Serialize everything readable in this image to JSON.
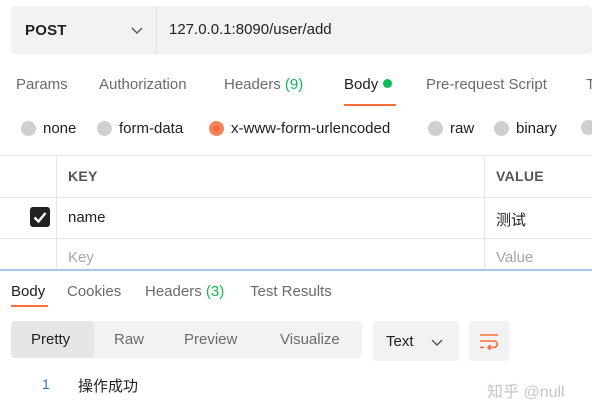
{
  "request": {
    "method": "POST",
    "url": "127.0.0.1:8090/user/add"
  },
  "request_tabs": {
    "params": "Params",
    "authorization": "Authorization",
    "headers": "Headers",
    "headers_count": "(9)",
    "body": "Body",
    "prerequest": "Pre-request Script",
    "tests_partial": "T"
  },
  "body_types": {
    "none": "none",
    "form_data": "form-data",
    "urlencoded": "x-www-form-urlencoded",
    "raw": "raw",
    "binary": "binary",
    "selected": "x-www-form-urlencoded"
  },
  "params_table": {
    "key_header": "KEY",
    "value_header": "VALUE",
    "rows": [
      {
        "key": "name",
        "value": "测试",
        "checked": true
      }
    ],
    "key_placeholder": "Key",
    "value_placeholder": "Value"
  },
  "response_tabs": {
    "body": "Body",
    "cookies": "Cookies",
    "headers": "Headers",
    "headers_count": "(3)",
    "test_results": "Test Results"
  },
  "response_view": {
    "pretty": "Pretty",
    "raw": "Raw",
    "preview": "Preview",
    "visualize": "Visualize",
    "format": "Text"
  },
  "response_body": {
    "line_number": "1",
    "text": "操作成功"
  },
  "watermark": "知乎 @null",
  "colors": {
    "accent": "#ff6c37",
    "count_green": "#0cbb52",
    "line_number_blue": "#2f6fb6"
  }
}
